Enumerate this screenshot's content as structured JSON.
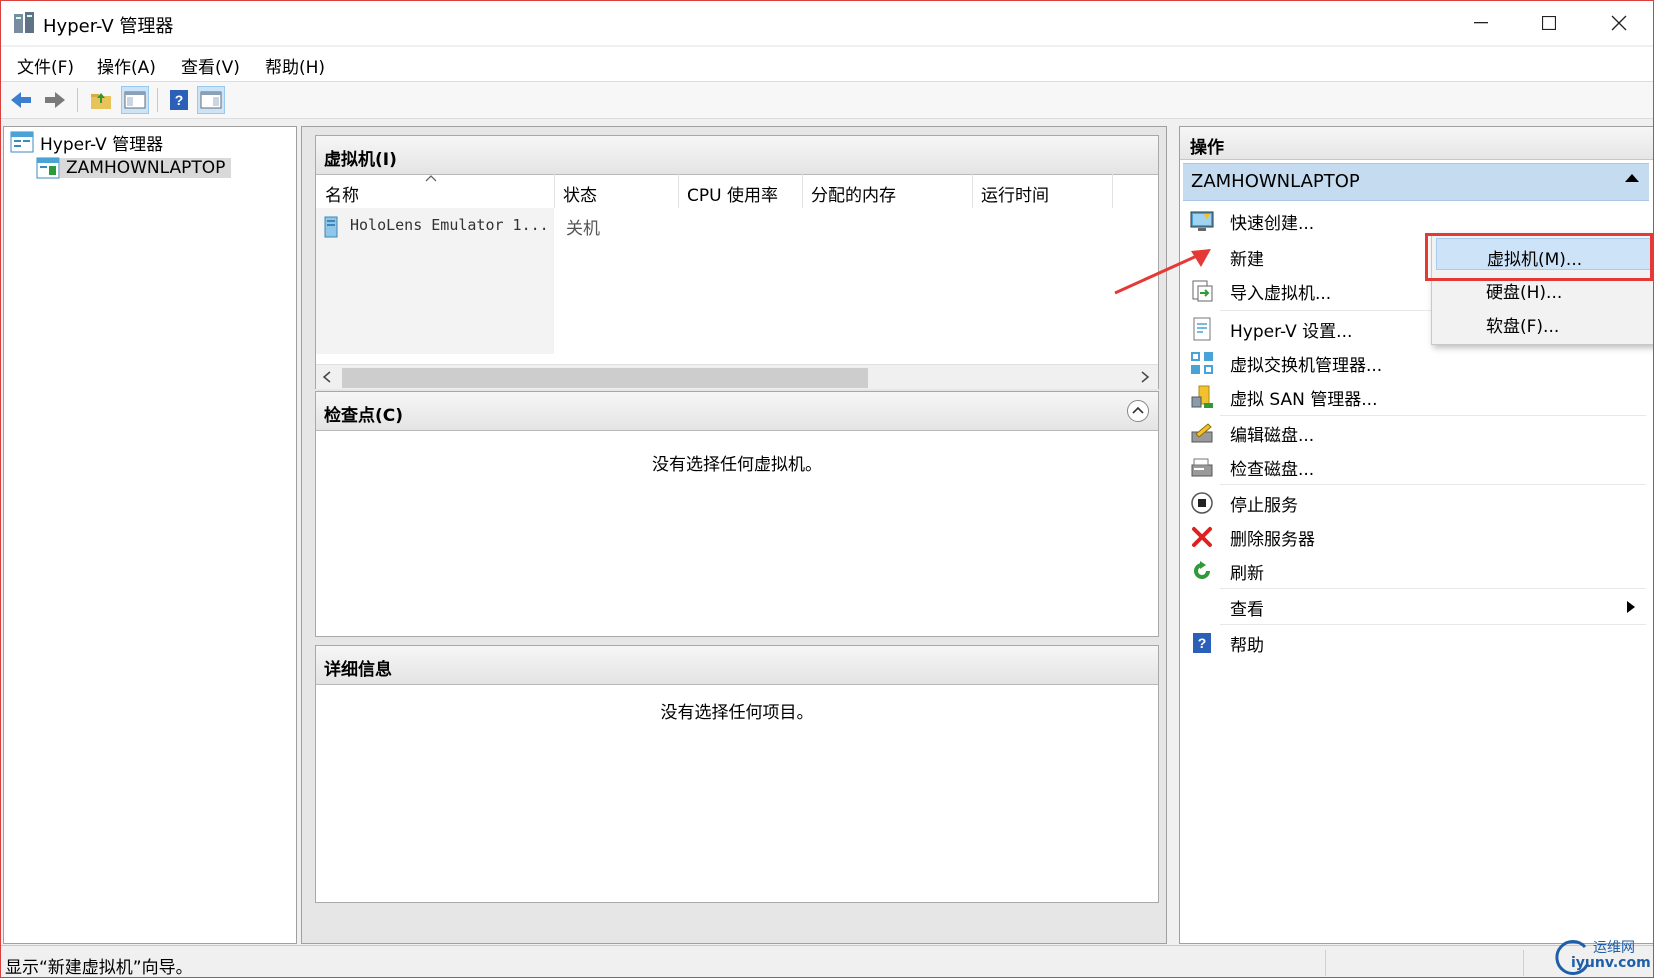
{
  "window": {
    "title": "Hyper-V 管理器",
    "accent": "#d84040"
  },
  "menu": {
    "items": [
      "文件(F)",
      "操作(A)",
      "查看(V)",
      "帮助(H)"
    ]
  },
  "toolbar": {
    "icons": [
      "back-arrow-icon",
      "forward-arrow-icon",
      "up-folder-icon",
      "show-tree-icon",
      "help-icon",
      "show-actions-icon"
    ]
  },
  "tree": {
    "root": "Hyper-V 管理器",
    "server": "ZAMHOWNLAPTOP"
  },
  "vm_pane": {
    "title": "虚拟机(I)",
    "columns": [
      "名称",
      "状态",
      "CPU 使用率",
      "分配的内存",
      "运行时间"
    ],
    "rows": [
      {
        "name": "HoloLens Emulator 1...",
        "state": "关机"
      }
    ]
  },
  "checkpoint_pane": {
    "title": "检查点(C)",
    "empty": "没有选择任何虚拟机。"
  },
  "details_pane": {
    "title": "详细信息",
    "empty": "没有选择任何项目。"
  },
  "actions": {
    "title": "操作",
    "section": "ZAMHOWNLAPTOP",
    "items": [
      "快速创建...",
      "新建",
      "导入虚拟机...",
      "Hyper-V 设置...",
      "虚拟交换机管理器...",
      "虚拟 SAN 管理器...",
      "编辑磁盘...",
      "检查磁盘...",
      "停止服务",
      "删除服务器",
      "刷新",
      "查看",
      "帮助"
    ]
  },
  "new_submenu": {
    "items": [
      "虚拟机(M)...",
      "硬盘(H)...",
      "软盘(F)..."
    ],
    "highlight_color": "#cde3f7"
  },
  "status": {
    "text": "显示“新建虚拟机”向导。"
  },
  "watermark": {
    "cn": "运维网",
    "en": "iyunv.com"
  }
}
